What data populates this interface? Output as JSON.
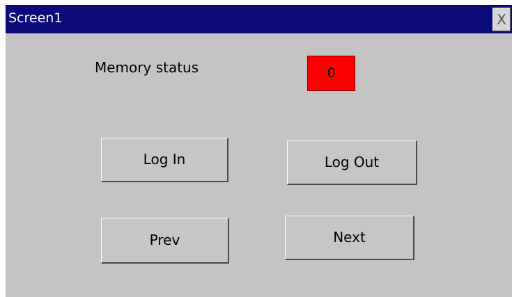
{
  "window": {
    "title": "Screen1",
    "close_label": "X"
  },
  "memory": {
    "label": "Memory status",
    "value": "0",
    "indicator_color": "#ff0000"
  },
  "buttons": {
    "login": "Log In",
    "logout": "Log Out",
    "prev": "Prev",
    "next": "Next"
  },
  "colors": {
    "titlebar": "#0a0a78",
    "background": "#c4c4c4"
  }
}
